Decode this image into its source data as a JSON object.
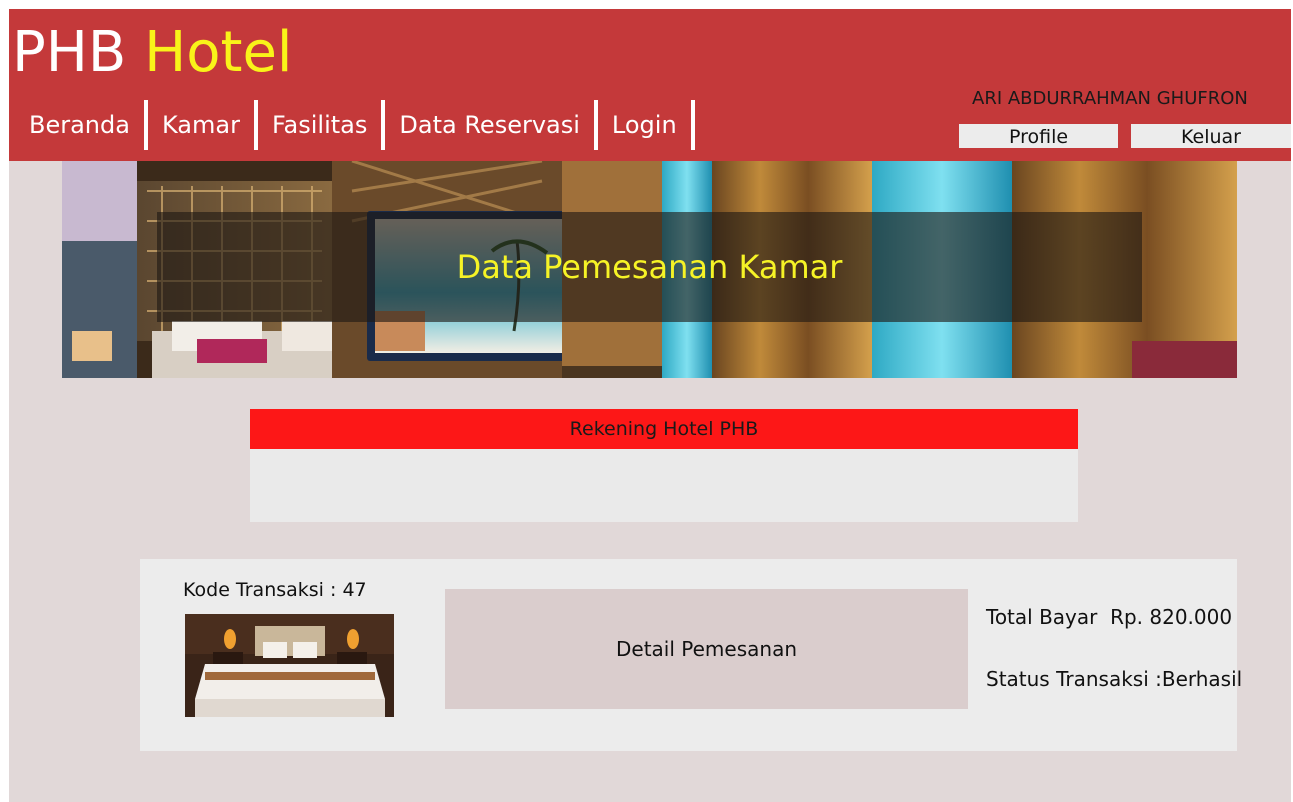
{
  "header": {
    "brand_main": "PHB",
    "brand_accent": "Hotel",
    "nav": [
      "Beranda",
      "Kamar",
      "Fasilitas",
      "Data Reservasi",
      "Login"
    ],
    "username": "ARI ABDURRAHMAN GHUFRON",
    "profile_label": "Profile",
    "logout_label": "Keluar"
  },
  "banner": {
    "title": "Data Pemesanan Kamar"
  },
  "rekening": {
    "title": "Rekening Hotel PHB"
  },
  "transaction": {
    "code_label": "Kode Transaksi : 47",
    "detail_label": "Detail Pemesanan",
    "total_label": "Total Bayar  Rp. 820.000",
    "status_label": "Status Transaksi :Berhasil"
  },
  "colors": {
    "header_bg": "#c4393a",
    "brand_accent": "#f9f319",
    "page_bg": "#e1d8d8",
    "rekening_header": "#fd1717",
    "banner_title": "#f6f326"
  }
}
